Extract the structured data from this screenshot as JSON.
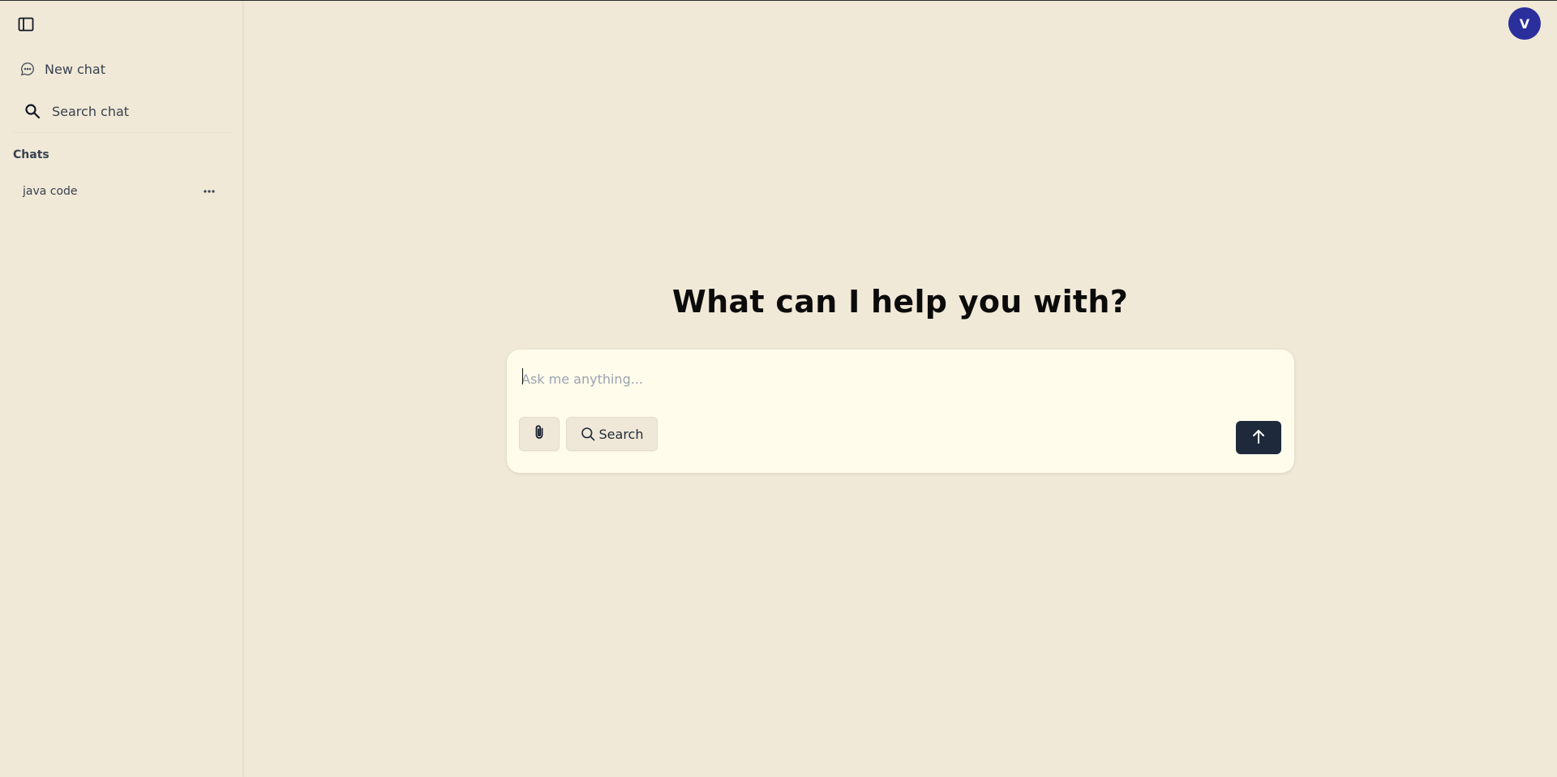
{
  "sidebar": {
    "toggle_icon": "sidebar-toggle-icon",
    "new_chat": {
      "label": "New chat",
      "icon": "chat-bubble-icon"
    },
    "search_chat": {
      "label": "Search chat",
      "icon": "search-icon"
    },
    "section_title": "Chats",
    "chats": [
      {
        "label": "java code",
        "more_icon": "ellipsis-icon"
      }
    ]
  },
  "user": {
    "avatar_initial": "V",
    "avatar_color": "#2a2f9c"
  },
  "main": {
    "heading": "What can I help you with?",
    "composer": {
      "placeholder": "Ask me anything...",
      "value": "",
      "attach_icon": "paperclip-icon",
      "search_label": "Search",
      "search_icon": "search-icon",
      "send_icon": "arrow-up-icon"
    }
  },
  "colors": {
    "background": "#f1e9d7",
    "composer_bg": "#fffcec",
    "send_button": "#1e293b"
  }
}
